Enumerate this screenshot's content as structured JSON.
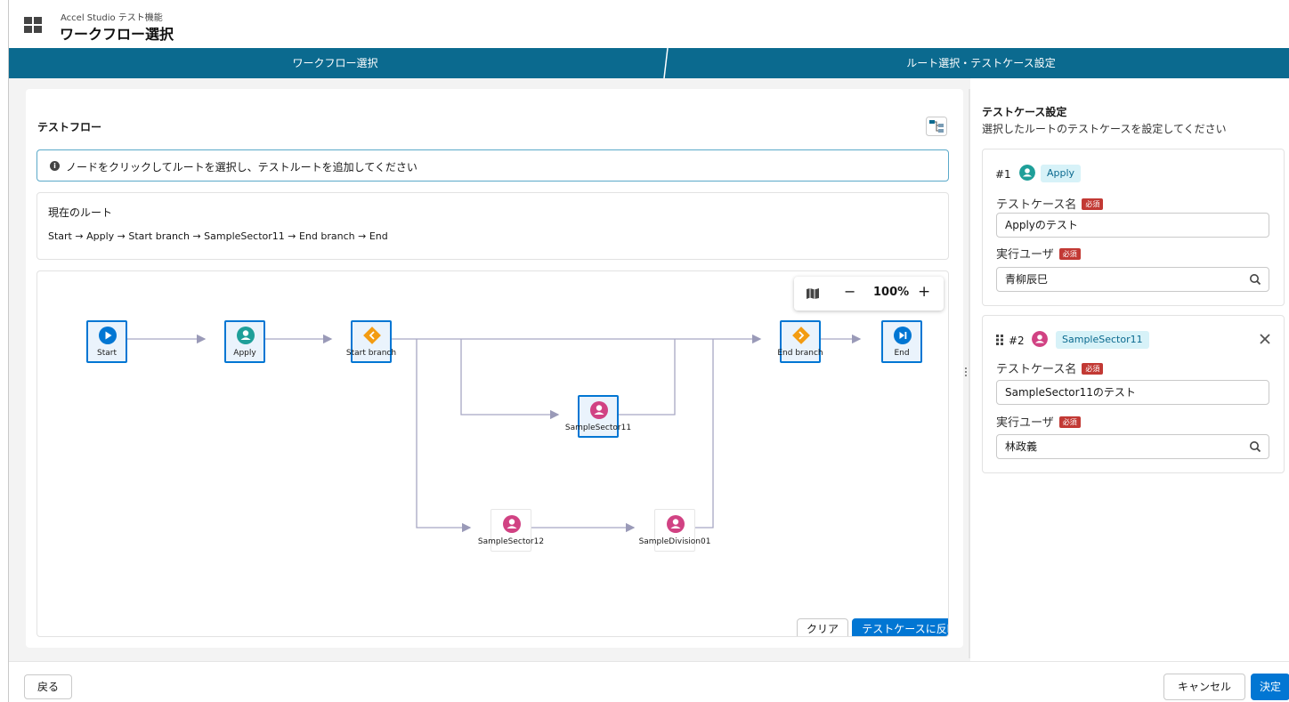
{
  "header": {
    "subtitle": "Accel Studio テスト機能",
    "title": "ワークフロー選択"
  },
  "steps": [
    {
      "label": "ワークフロー選択"
    },
    {
      "label": "ルート選択・テストケース設定"
    }
  ],
  "flow": {
    "section_title": "テストフロー",
    "info_text": "ノードをクリックしてルートを選択し、テストルートを追加してください",
    "current_route_label": "現在のルート",
    "current_route": "Start → Apply → Start branch → SampleSector11 → End branch → End",
    "zoom": {
      "minus": "−",
      "level": "100%",
      "plus": "+"
    },
    "nodes": {
      "start": "Start",
      "apply": "Apply",
      "start_branch": "Start branch",
      "end_branch": "End branch",
      "end": "End",
      "sector11": "SampleSector11",
      "sector12": "SampleSector12",
      "division01": "SampleDivision01"
    },
    "clear_label": "クリア",
    "apply_label": "テストケースに反映"
  },
  "testcases": {
    "title": "テストケース設定",
    "description": "選択したルートのテストケースを設定してください",
    "name_label": "テストケース名",
    "user_label": "実行ユーザ",
    "required_label": "必須",
    "items": [
      {
        "num": "#1",
        "node": "Apply",
        "name": "Applyのテスト",
        "user": "青柳辰巳"
      },
      {
        "num": "#2",
        "node": "SampleSector11",
        "name": "SampleSector11のテスト",
        "user": "林政義"
      }
    ],
    "colors": {
      "apply_avatar": "#1e9f99",
      "sector_avatar": "#d14283"
    }
  },
  "footer": {
    "back_label": "戻る",
    "cancel_label": "キャンセル",
    "decide_label": "決定"
  },
  "colors": {
    "steps_bar": "#0b6a8f",
    "brand": "#0176d3",
    "branch": "#f39c12",
    "required": "#c23934"
  }
}
